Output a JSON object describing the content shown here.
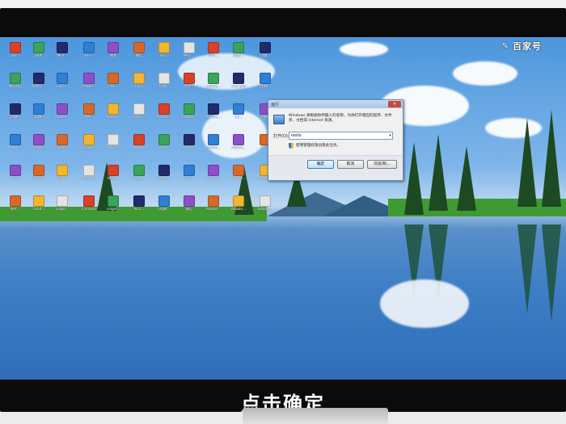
{
  "brand": {
    "name": "百家号",
    "edit_label": "✎"
  },
  "caption": "点击确定",
  "desktop_icons": [
    [
      "3D...",
      "腾讯QQ",
      "[高精...",
      "Adobe...",
      "720...",
      "Net..."
    ],
    [
      "网易",
      "网易云...",
      "[高精...",
      "Adobe...",
      "Scan...",
      "cand..."
    ],
    [
      "腾讯...",
      "2345...",
      "Adobe...",
      "Adobe...",
      "360...",
      "Edge..."
    ],
    [
      "360...",
      "Adobe...",
      "文件...",
      "Google...",
      "Bandi...",
      "Chrome"
    ],
    [
      "网易",
      "QQ...",
      "Adobe...",
      "Adobe...",
      "WPS...",
      "Edge..."
    ],
    [
      "微信",
      "Lipd",
      "2345...",
      "Adobe...",
      "Edge...",
      "Picc..."
    ],
    [
      "360...",
      "控制...",
      "Adobe...",
      "Adobe...",
      "Adobe...",
      "[高精..."
    ],
    [
      "腾讯...",
      "文件...",
      "Adobe...",
      "Adobe...",
      "360...",
      "微信"
    ],
    [
      "360...",
      "Adobe...",
      "Adobe...",
      "Adobe...",
      "Adobe...",
      "Adobe..."
    ],
    [
      "新建...",
      "123.psd",
      "23...",
      "Adobe...",
      "Adobe...",
      "Adobe..."
    ],
    [
      "回收...",
      "[高精...",
      "[高精...",
      "Ae...",
      "Adobe...",
      "Adobe..."
    ]
  ],
  "run_dialog": {
    "title": "运行",
    "description": "Windows 将根据你所输入的名称，为你打开相应的程序、文件夹、文档或 Internet 资源。",
    "open_label": "打开(O):",
    "input_value": "resto",
    "admin_note": "使用管理权限创建此任务。",
    "ok_label": "确定",
    "cancel_label": "取消",
    "browse_label": "浏览(B)..."
  },
  "colors": {
    "sky": "#4c96dc",
    "lake": "#2f6eb7",
    "grass": "#3f9a33",
    "trees": "#1d4a22"
  }
}
